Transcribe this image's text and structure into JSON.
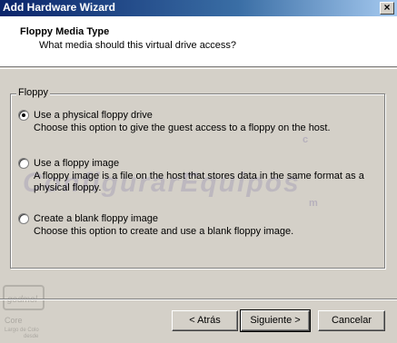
{
  "window": {
    "title": "Add Hardware Wizard",
    "close_label": "×"
  },
  "header": {
    "title": "Floppy Media Type",
    "subtitle": "What media should this virtual drive access?"
  },
  "group": {
    "label": "Floppy",
    "options": [
      {
        "label": "Use a physical floppy drive",
        "description": "Choose this option to give the guest access to a floppy on the host.",
        "checked": true
      },
      {
        "label": "Use a floppy image",
        "description": "A floppy image is a file on the host that stores data in the same format as a physical floppy.",
        "checked": false
      },
      {
        "label": "Create a blank floppy image",
        "description": "Choose this option to create and use a blank floppy image.",
        "checked": false
      }
    ]
  },
  "watermark": {
    "text": "ConfigurarEquipos",
    "c": "c",
    "m": "m"
  },
  "logo": {
    "name": "godmol",
    "line1": "Core",
    "line2": "Largo de Colo",
    "line3": "desde"
  },
  "buttons": {
    "back": "< Atrás",
    "next": "Siguiente >",
    "cancel": "Cancelar"
  }
}
